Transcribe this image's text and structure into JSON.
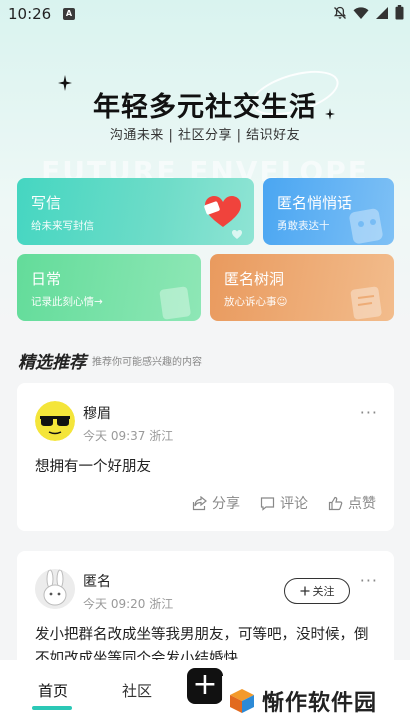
{
  "status_bar": {
    "time": "10:26",
    "notif_badge": "A"
  },
  "hero": {
    "title": "年轻多元社交生活",
    "subtitle": "沟通未来 | 社区分享 | 结识好友",
    "bg_text": "FUTURE ENVELOPE"
  },
  "cards": {
    "write": {
      "title": "写信",
      "subtitle": "给未来写封信"
    },
    "anon": {
      "title": "匿名悄悄话",
      "subtitle": "勇敢表达十"
    },
    "daily": {
      "title": "日常",
      "subtitle": "记录此刻心情→"
    },
    "tree": {
      "title": "匿名树洞",
      "subtitle": "放心诉心事☺"
    }
  },
  "section": {
    "title": "精选推荐",
    "subtitle": "推荐你可能感兴趣的内容"
  },
  "posts": [
    {
      "author": "穆眉",
      "meta": "今天 09:37 浙江",
      "content": "想拥有一个好朋友",
      "actions": {
        "share": "分享",
        "comment": "评论",
        "like": "点赞"
      },
      "more": "···"
    },
    {
      "author": "匿名",
      "meta": "今天 09:20 浙江",
      "follow": "关注",
      "content": "发小把群名改成坐等我男朋友，可等吧，没时候，倒不如改成坐等同个会发小结婚快",
      "more": "···"
    }
  ],
  "nav": {
    "home": "首页",
    "community": "社区",
    "add": "+"
  },
  "watermark": {
    "text": "惭作软件园"
  },
  "colors": {
    "accent": "#2bc8b6"
  }
}
